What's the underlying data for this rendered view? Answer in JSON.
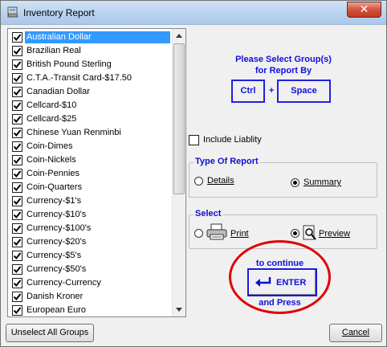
{
  "window": {
    "title": "Inventory Report",
    "close_label": "✕"
  },
  "list": {
    "items": [
      {
        "label": "Australian Dollar",
        "checked": true,
        "selected": true
      },
      {
        "label": "Brazilian Real",
        "checked": true
      },
      {
        "label": "British Pound Sterling",
        "checked": true
      },
      {
        "label": "C.T.A.-Transit Card-$17.50",
        "checked": true
      },
      {
        "label": "Canadian Dollar",
        "checked": true
      },
      {
        "label": "Cellcard-$10",
        "checked": true
      },
      {
        "label": "Cellcard-$25",
        "checked": true
      },
      {
        "label": "Chinese Yuan Renminbi",
        "checked": true
      },
      {
        "label": "Coin-Dimes",
        "checked": true
      },
      {
        "label": "Coin-Nickels",
        "checked": true
      },
      {
        "label": "Coin-Pennies",
        "checked": true
      },
      {
        "label": "Coin-Quarters",
        "checked": true
      },
      {
        "label": "Currency-$1's",
        "checked": true
      },
      {
        "label": "Currency-$10's",
        "checked": true
      },
      {
        "label": "Currency-$100's",
        "checked": true
      },
      {
        "label": "Currency-$20's",
        "checked": true
      },
      {
        "label": "Currency-$5's",
        "checked": true
      },
      {
        "label": "Currency-$50's",
        "checked": true
      },
      {
        "label": "Currency-Currency",
        "checked": true
      },
      {
        "label": "Danish Kroner",
        "checked": true
      },
      {
        "label": "European Euro",
        "checked": true
      }
    ]
  },
  "instructions": {
    "line1": "Please Select  Group(s)",
    "line2": "for Report By",
    "key1": "Ctrl",
    "plus": "+",
    "key2": "Space"
  },
  "include_liability": {
    "label": "Include Liablity",
    "checked": false
  },
  "type_group": {
    "title": "Type Of Report",
    "options": [
      {
        "label": "Details",
        "selected": false
      },
      {
        "label": "Summary",
        "selected": true
      }
    ]
  },
  "select_group": {
    "title": "Select",
    "options": [
      {
        "label": "Print",
        "selected": false,
        "icon": "printer-icon"
      },
      {
        "label": "Preview",
        "selected": true,
        "icon": "preview-icon"
      }
    ]
  },
  "enter": {
    "top_text": "to continue",
    "label": "ENTER",
    "bottom_text": "and Press",
    "highlight_color": "#e00000"
  },
  "buttons": {
    "unselect_all": "Unselect All Groups",
    "cancel": "Cancel"
  }
}
